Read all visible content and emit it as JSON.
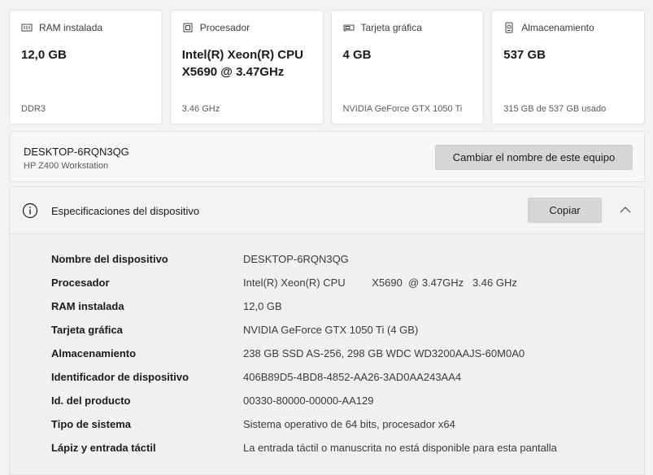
{
  "cards": [
    {
      "label": "RAM instalada",
      "value": "12,0 GB",
      "sub": "DDR3",
      "icon": "ram-icon"
    },
    {
      "label": "Procesador",
      "value": "Intel(R) Xeon(R) CPU X5690  @ 3.47GHz",
      "sub": "3.46 GHz",
      "icon": "processor-icon"
    },
    {
      "label": "Tarjeta gráfica",
      "value": "4 GB",
      "sub": "NVIDIA GeForce GTX 1050 Ti",
      "icon": "graphics-card-icon"
    },
    {
      "label": "Almacenamiento",
      "value": "537 GB",
      "sub": "315 GB de 537 GB usado",
      "icon": "storage-icon"
    }
  ],
  "device": {
    "name": "DESKTOP-6RQN3QG",
    "model": "HP Z400 Workstation",
    "rename_label": "Cambiar el nombre de este equipo"
  },
  "specs": {
    "title": "Especificaciones del dispositivo",
    "copy_label": "Copiar",
    "rows": [
      {
        "label": "Nombre del dispositivo",
        "value": "DESKTOP-6RQN3QG"
      },
      {
        "label": "Procesador",
        "value": "Intel(R) Xeon(R) CPU         X5690  @ 3.47GHz   3.46 GHz"
      },
      {
        "label": "RAM instalada",
        "value": "12,0 GB"
      },
      {
        "label": "Tarjeta gráfica",
        "value": "NVIDIA GeForce GTX 1050 Ti (4 GB)"
      },
      {
        "label": "Almacenamiento",
        "value": "238 GB SSD AS-256, 298 GB WDC WD3200AAJS-60M0A0"
      },
      {
        "label": "Identificador de dispositivo",
        "value": "406B89D5-4BD8-4852-AA26-3AD0AA243AA4"
      },
      {
        "label": "Id. del producto",
        "value": "00330-80000-00000-AA129"
      },
      {
        "label": "Tipo de sistema",
        "value": "Sistema operativo de 64 bits, procesador x64"
      },
      {
        "label": "Lápiz y entrada táctil",
        "value": "La entrada táctil o manuscrita no está disponible para esta pantalla"
      }
    ]
  }
}
